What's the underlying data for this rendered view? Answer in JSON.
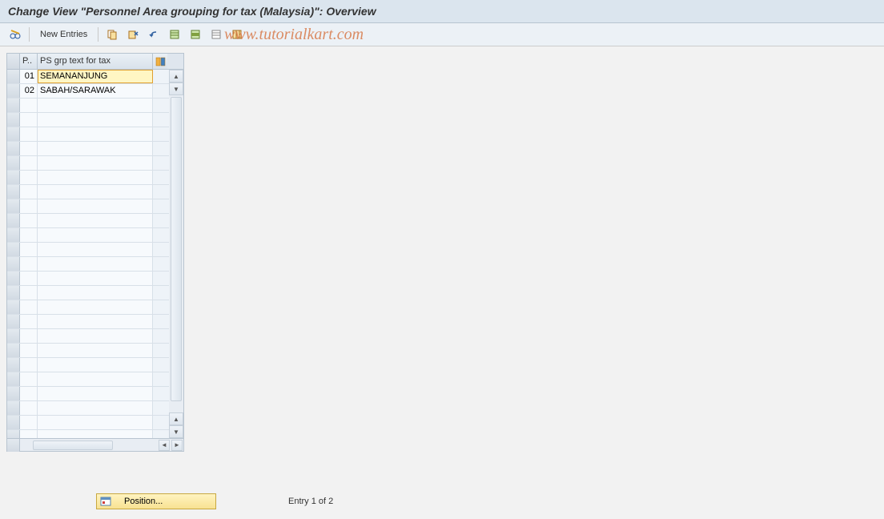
{
  "title": "Change View \"Personnel Area grouping for tax (Malaysia)\": Overview",
  "toolbar": {
    "new_entries_label": "New Entries"
  },
  "watermark": "www.tutorialkart.com",
  "table": {
    "headers": {
      "p": "P..",
      "text": "PS grp text for tax"
    },
    "rows": [
      {
        "p": "01",
        "text": "SEMANANJUNG",
        "focused": true
      },
      {
        "p": "02",
        "text": "SABAH/SARAWAK",
        "focused": false
      }
    ],
    "empty_rows": 24
  },
  "footer": {
    "position_label": "Position...",
    "entry_text": "Entry 1 of 2"
  }
}
